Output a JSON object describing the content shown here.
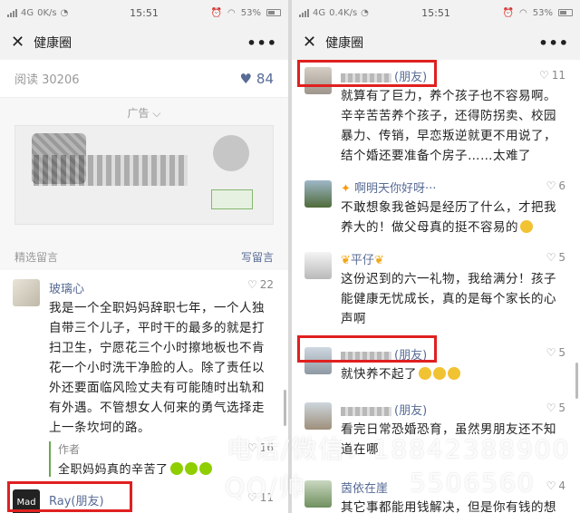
{
  "left": {
    "status": {
      "network": "4G",
      "speed": "0K/s",
      "time": "15:51",
      "battery": "53%"
    },
    "nav": {
      "close": "✕",
      "title": "健康圈",
      "more": "•••"
    },
    "read": {
      "label": "阅读 30206",
      "likes": "84"
    },
    "ad": {
      "label": "广告 ⌵"
    },
    "section": {
      "title": "精选留言",
      "write": "写留言"
    },
    "comment1": {
      "name": "玻璃心",
      "likes": "22",
      "text": "我是一个全职妈妈辞职七年，一个人独自带三个儿子，平时干的最多的就是打扫卫生，宁愿花三个小时擦地板也不肯花一个小时洗干净脸的人。除了责任以外还要面临风险丈夫有可能随时出轨和有外遇。不管想女人何来的勇气选择走上一条坎坷的路。",
      "reply_label": "作者",
      "reply_text": "全职妈妈真的辛苦了",
      "reply_likes": "16"
    },
    "comment2": {
      "name": "Ray(朋友)",
      "likes": "11",
      "avatar": "Mad"
    }
  },
  "right": {
    "status": {
      "network": "4G",
      "speed": "0.4K/s",
      "time": "15:51",
      "battery": "53%"
    },
    "nav": {
      "close": "✕",
      "title": "健康圈",
      "more": "•••"
    },
    "c1": {
      "tag": "(朋友)",
      "likes": "11",
      "text": "就算有了巨力，养个孩子也不容易啊。辛辛苦苦养个孩子，还得防拐卖、校园暴力、传销，早恋叛逆就更不用说了，结个婚还要准备个房子……太难了"
    },
    "c2": {
      "name": "啊明天你好呀···",
      "likes": "6",
      "text": "不敢想象我爸妈是经历了什么，才把我养大的！做父母真的挺不容易的"
    },
    "c3": {
      "name": "平仔",
      "likes": "5",
      "text": "这份迟到的六一礼物，我给满分！孩子能健康无忧成长，真的是每个家长的心声啊"
    },
    "c4": {
      "tag": "(朋友)",
      "likes": "5",
      "text": "就快养不起了"
    },
    "c5": {
      "tag": "(朋友)",
      "likes": "5",
      "text": "看完日常恐婚恐育，虽然男朋友还不知道在哪"
    },
    "c6": {
      "name": "茵依在崖",
      "likes": "4",
      "text": "其它事都能用钱解决，但是你有钱的想"
    }
  },
  "watermark": {
    "line1": "电话/微信：18842388900",
    "line2": "QQ/帅",
    "line3": "5506560"
  }
}
